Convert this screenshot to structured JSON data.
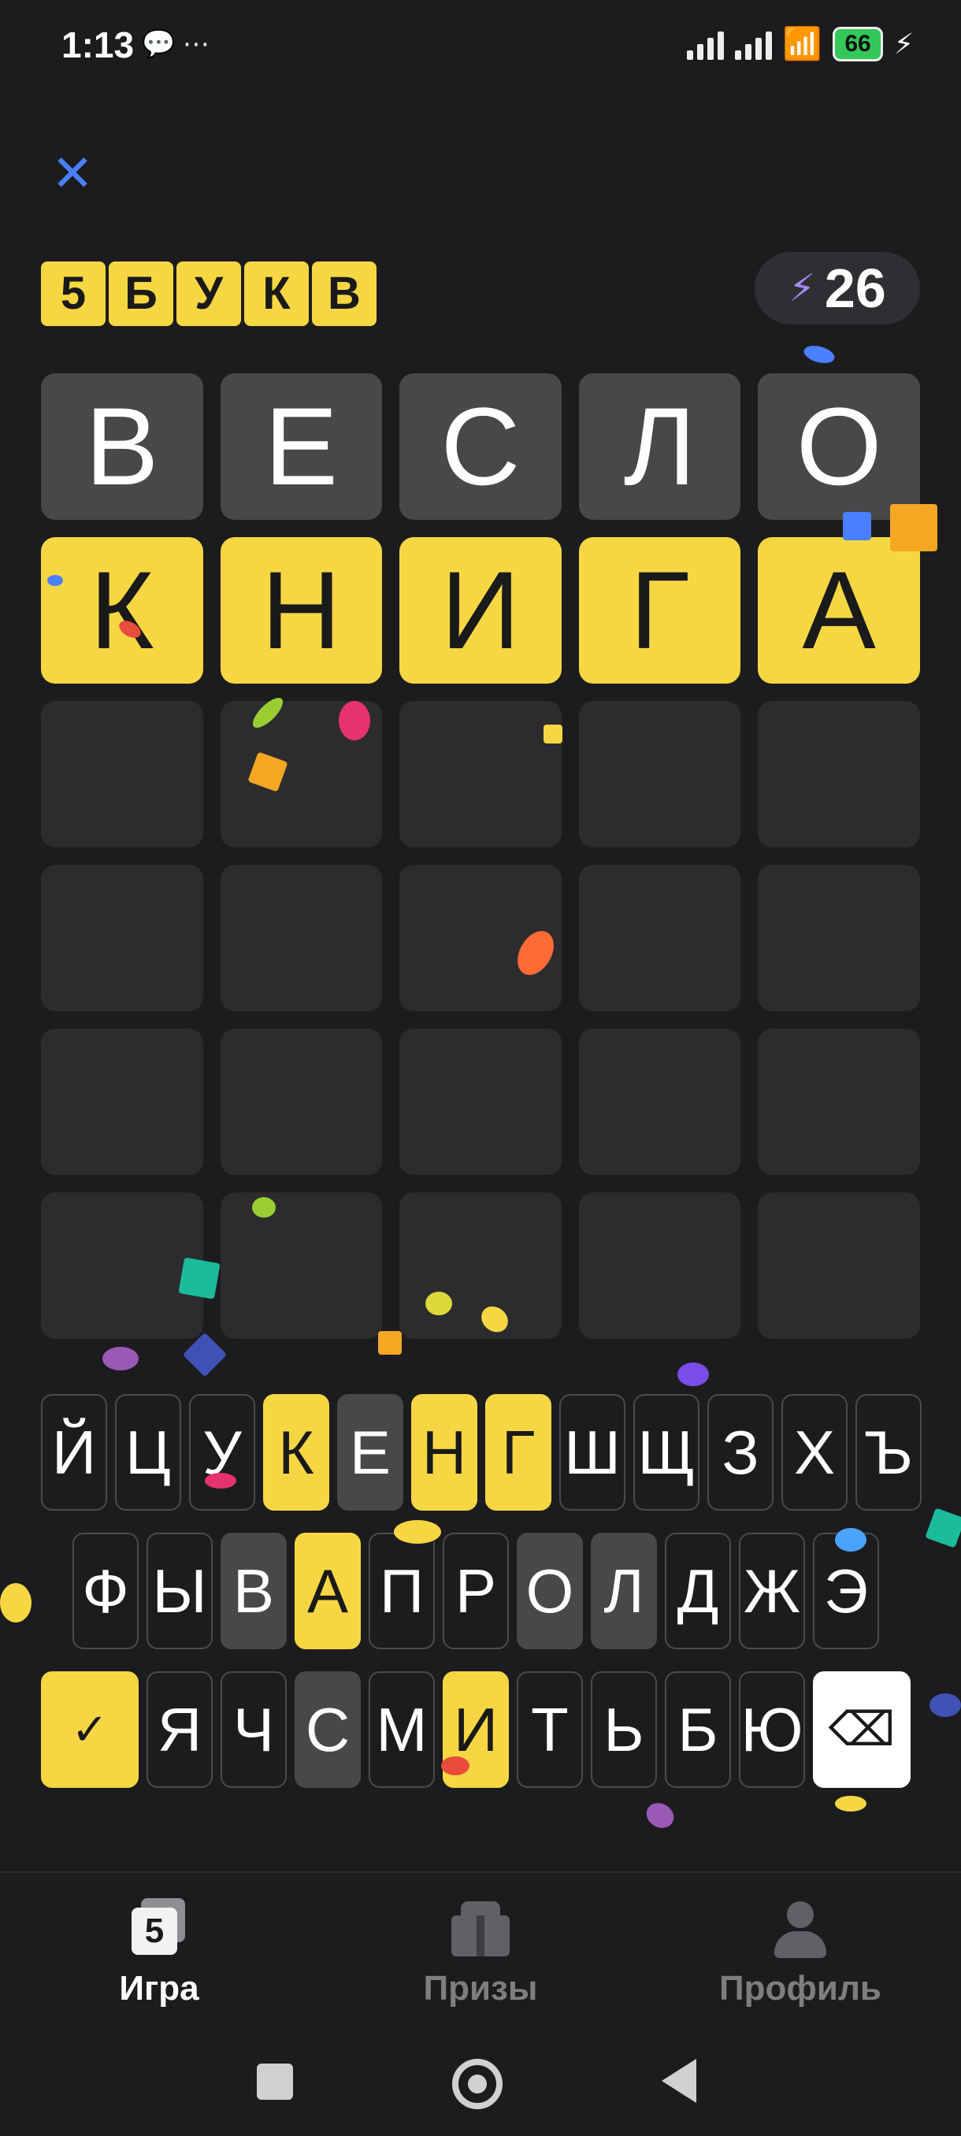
{
  "status": {
    "time": "1:13",
    "extra": "⋯",
    "battery": "66"
  },
  "header": {
    "brand_letters": [
      "5",
      "Б",
      "У",
      "К",
      "В"
    ],
    "energy_count": "26"
  },
  "board": {
    "rows": [
      [
        {
          "l": "В",
          "s": "gray"
        },
        {
          "l": "Е",
          "s": "gray"
        },
        {
          "l": "С",
          "s": "gray"
        },
        {
          "l": "Л",
          "s": "gray"
        },
        {
          "l": "О",
          "s": "gray"
        }
      ],
      [
        {
          "l": "К",
          "s": "yellow"
        },
        {
          "l": "Н",
          "s": "yellow"
        },
        {
          "l": "И",
          "s": "yellow"
        },
        {
          "l": "Г",
          "s": "yellow"
        },
        {
          "l": "А",
          "s": "yellow"
        }
      ],
      [
        {
          "l": "",
          "s": "empty"
        },
        {
          "l": "",
          "s": "empty"
        },
        {
          "l": "",
          "s": "empty"
        },
        {
          "l": "",
          "s": "empty"
        },
        {
          "l": "",
          "s": "empty"
        }
      ],
      [
        {
          "l": "",
          "s": "empty"
        },
        {
          "l": "",
          "s": "empty"
        },
        {
          "l": "",
          "s": "empty"
        },
        {
          "l": "",
          "s": "empty"
        },
        {
          "l": "",
          "s": "empty"
        }
      ],
      [
        {
          "l": "",
          "s": "empty"
        },
        {
          "l": "",
          "s": "empty"
        },
        {
          "l": "",
          "s": "empty"
        },
        {
          "l": "",
          "s": "empty"
        },
        {
          "l": "",
          "s": "empty"
        }
      ],
      [
        {
          "l": "",
          "s": "empty"
        },
        {
          "l": "",
          "s": "empty"
        },
        {
          "l": "",
          "s": "empty"
        },
        {
          "l": "",
          "s": "empty"
        },
        {
          "l": "",
          "s": "empty"
        }
      ]
    ]
  },
  "keyboard": {
    "row1": [
      {
        "k": "Й",
        "s": ""
      },
      {
        "k": "Ц",
        "s": ""
      },
      {
        "k": "У",
        "s": ""
      },
      {
        "k": "К",
        "s": "yellow"
      },
      {
        "k": "Е",
        "s": "gray"
      },
      {
        "k": "Н",
        "s": "yellow"
      },
      {
        "k": "Г",
        "s": "yellow"
      },
      {
        "k": "Ш",
        "s": ""
      },
      {
        "k": "Щ",
        "s": ""
      },
      {
        "k": "З",
        "s": ""
      },
      {
        "k": "Х",
        "s": ""
      },
      {
        "k": "Ъ",
        "s": ""
      }
    ],
    "row2": [
      {
        "k": "Ф",
        "s": ""
      },
      {
        "k": "Ы",
        "s": ""
      },
      {
        "k": "В",
        "s": "gray"
      },
      {
        "k": "А",
        "s": "yellow"
      },
      {
        "k": "П",
        "s": ""
      },
      {
        "k": "Р",
        "s": ""
      },
      {
        "k": "О",
        "s": "gray"
      },
      {
        "k": "Л",
        "s": "gray"
      },
      {
        "k": "Д",
        "s": ""
      },
      {
        "k": "Ж",
        "s": ""
      },
      {
        "k": "Э",
        "s": ""
      }
    ],
    "row3": [
      {
        "k": "Я",
        "s": ""
      },
      {
        "k": "Ч",
        "s": ""
      },
      {
        "k": "С",
        "s": "gray"
      },
      {
        "k": "М",
        "s": ""
      },
      {
        "k": "И",
        "s": "yellow"
      },
      {
        "k": "Т",
        "s": ""
      },
      {
        "k": "Ь",
        "s": ""
      },
      {
        "k": "Б",
        "s": ""
      },
      {
        "k": "Ю",
        "s": ""
      }
    ],
    "enter_label": "✓",
    "backspace_label": "⌫"
  },
  "tabs": [
    {
      "label": "Игра",
      "state": "active",
      "icon": "game-icon"
    },
    {
      "label": "Призы",
      "state": "inactive",
      "icon": "gift-icon"
    },
    {
      "label": "Профиль",
      "state": "inactive",
      "icon": "profile-icon"
    }
  ],
  "colors": {
    "yellow": "#f6d743",
    "gray": "#48484a",
    "empty": "#2c2c2e",
    "accent": "#4a7fff"
  }
}
